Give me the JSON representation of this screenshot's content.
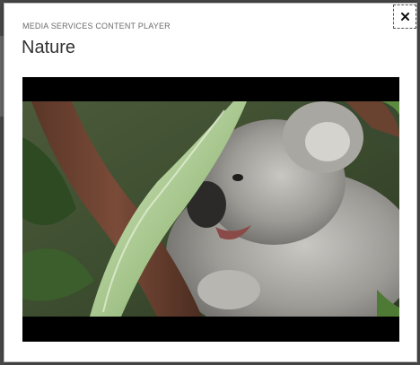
{
  "dialog": {
    "overline": "MEDIA SERVICES CONTENT PLAYER",
    "title": "Nature",
    "close_icon": "close-icon"
  },
  "video": {
    "subject": "koala-in-tree"
  },
  "colors": {
    "dialog_background": "#ffffff",
    "overlay": "#3a3a3a",
    "title_text": "#333333",
    "overline_text": "#6b6b6b",
    "video_letterbox": "#000000"
  }
}
